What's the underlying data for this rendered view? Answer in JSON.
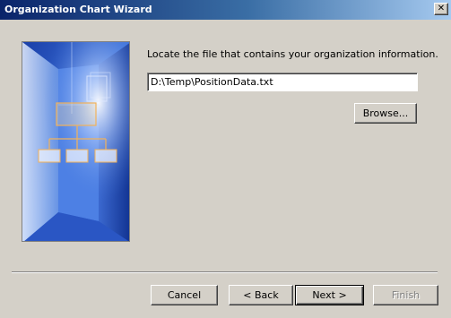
{
  "window": {
    "title": "Organization Chart Wizard",
    "close_glyph": "✕"
  },
  "main": {
    "prompt": "Locate the file that contains your organization information.",
    "file_path": "D:\\Temp\\PositionData.txt",
    "browse_label": "Browse..."
  },
  "footer": {
    "cancel_label": "Cancel",
    "back_label": "< Back",
    "next_label": "Next >",
    "finish_label": "Finish"
  },
  "icons": {
    "close": "close-icon",
    "wizard_art": "org-chart-illustration"
  },
  "colors": {
    "titlebar_start": "#0a246a",
    "titlebar_end": "#a6caf0",
    "dialog_bg": "#d4d0c8",
    "art_blue": "#1e50c8"
  }
}
